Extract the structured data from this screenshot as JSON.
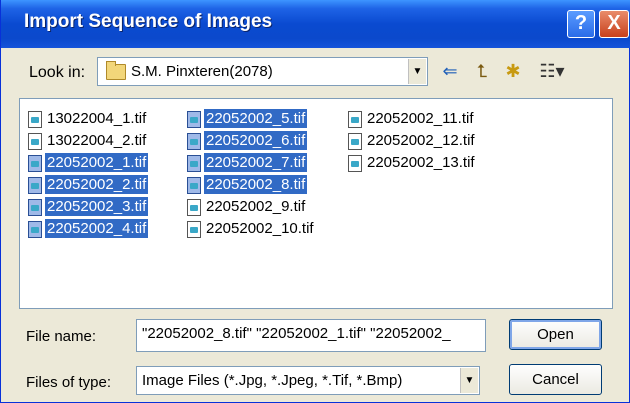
{
  "window": {
    "title": "Import Sequence of Images",
    "help_glyph": "?",
    "close_glyph": "X"
  },
  "lookin": {
    "label": "Look in:",
    "value": "S.M. Pinxteren(2078)"
  },
  "files": {
    "col1": [
      {
        "name": "13022004_1.tif",
        "selected": false
      },
      {
        "name": "13022004_2.tif",
        "selected": false
      },
      {
        "name": "22052002_1.tif",
        "selected": true
      },
      {
        "name": "22052002_2.tif",
        "selected": true
      },
      {
        "name": "22052002_3.tif",
        "selected": true
      },
      {
        "name": "22052002_4.tif",
        "selected": true
      }
    ],
    "col2": [
      {
        "name": "22052002_5.tif",
        "selected": true
      },
      {
        "name": "22052002_6.tif",
        "selected": true
      },
      {
        "name": "22052002_7.tif",
        "selected": true
      },
      {
        "name": "22052002_8.tif",
        "selected": true
      },
      {
        "name": "22052002_9.tif",
        "selected": false
      },
      {
        "name": "22052002_10.tif",
        "selected": false
      }
    ],
    "col3": [
      {
        "name": "22052002_11.tif",
        "selected": false
      },
      {
        "name": "22052002_12.tif",
        "selected": false
      },
      {
        "name": "22052002_13.tif",
        "selected": false
      }
    ]
  },
  "filename": {
    "label": "File name:",
    "value": "\"22052002_8.tif\" \"22052002_1.tif\" \"22052002_"
  },
  "filetype": {
    "label": "Files of type:",
    "value": "Image Files (*.Jpg, *.Jpeg, *.Tif, *.Bmp)"
  },
  "buttons": {
    "open": "Open",
    "cancel": "Cancel"
  },
  "toolbar": {
    "back_glyph": "⇐",
    "up_glyph": "⮤",
    "newfolder_glyph": "✱",
    "view_glyph": "☷▾"
  },
  "colors": {
    "titlebar": "#0a4ad0",
    "selection": "#316ac5",
    "dialog_bg": "#ece9d8"
  }
}
